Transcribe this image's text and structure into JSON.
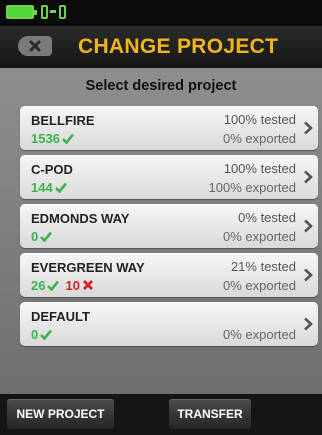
{
  "header": {
    "title": "CHANGE PROJECT"
  },
  "subtitle": "Select desired project",
  "projects": [
    {
      "name": "BELLFIRE",
      "pass_count": "1536",
      "fail_count": "",
      "tested": "100% tested",
      "exported": "0% exported"
    },
    {
      "name": "C-POD",
      "pass_count": "144",
      "fail_count": "",
      "tested": "100% tested",
      "exported": "100% exported"
    },
    {
      "name": "EDMONDS WAY",
      "pass_count": "0",
      "fail_count": "",
      "tested": "0% tested",
      "exported": "0% exported"
    },
    {
      "name": "EVERGREEN WAY",
      "pass_count": "26",
      "fail_count": "10",
      "tested": "21% tested",
      "exported": "0% exported"
    },
    {
      "name": "DEFAULT",
      "pass_count": "0",
      "fail_count": "",
      "tested": "",
      "exported": "0% exported"
    }
  ],
  "footer": {
    "new_project_label": "NEW PROJECT",
    "transfer_label": "TRANSFER"
  },
  "icons": {
    "battery": "battery-icon",
    "back": "back-close-icon",
    "pass": "check-icon",
    "fail": "x-icon",
    "row_action": "chevron-right-icon"
  },
  "colors": {
    "title": "#f2b516",
    "pass": "#39b54a",
    "fail": "#d3202e",
    "battery": "#4fd63a"
  }
}
